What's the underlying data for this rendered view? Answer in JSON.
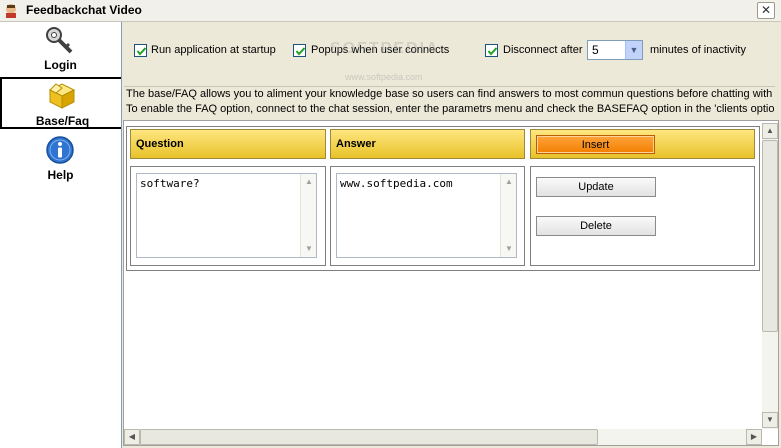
{
  "window": {
    "title": "Feedbackchat Video",
    "close_glyph": "✕"
  },
  "sidebar": {
    "items": [
      {
        "label": "Login",
        "icon": "key-icon"
      },
      {
        "label": "Base/Faq",
        "icon": "box-icon"
      },
      {
        "label": "Help",
        "icon": "info-icon"
      }
    ]
  },
  "options": {
    "run_at_startup": {
      "label": "Run application at startup",
      "checked": true
    },
    "popups": {
      "label": "Popups when user connects",
      "checked": true
    },
    "disconnect": {
      "label": "Disconnect after",
      "checked": true,
      "value": "5",
      "suffix": "minutes of inactivity"
    }
  },
  "info": {
    "line1": "The base/FAQ allows you to aliment your knowledge base so users can find answers to most commun questions before chatting with you.",
    "line2": "To enable the FAQ option, connect to the chat session, enter the parametrs menu and check the BASEFAQ option in the 'clients options'"
  },
  "faq": {
    "question_header": "Question",
    "answer_header": "Answer",
    "question_value": "software?",
    "answer_value": "www.softpedia.com",
    "insert_label": "Insert",
    "update_label": "Update",
    "delete_label": "Delete"
  },
  "watermark": {
    "main": "SOFTPEDIA",
    "sub": "www.softpedia.com"
  },
  "colors": {
    "header_gold": "#e8c229",
    "insert_orange": "#f27f00",
    "check_blue": "#1c5180"
  }
}
